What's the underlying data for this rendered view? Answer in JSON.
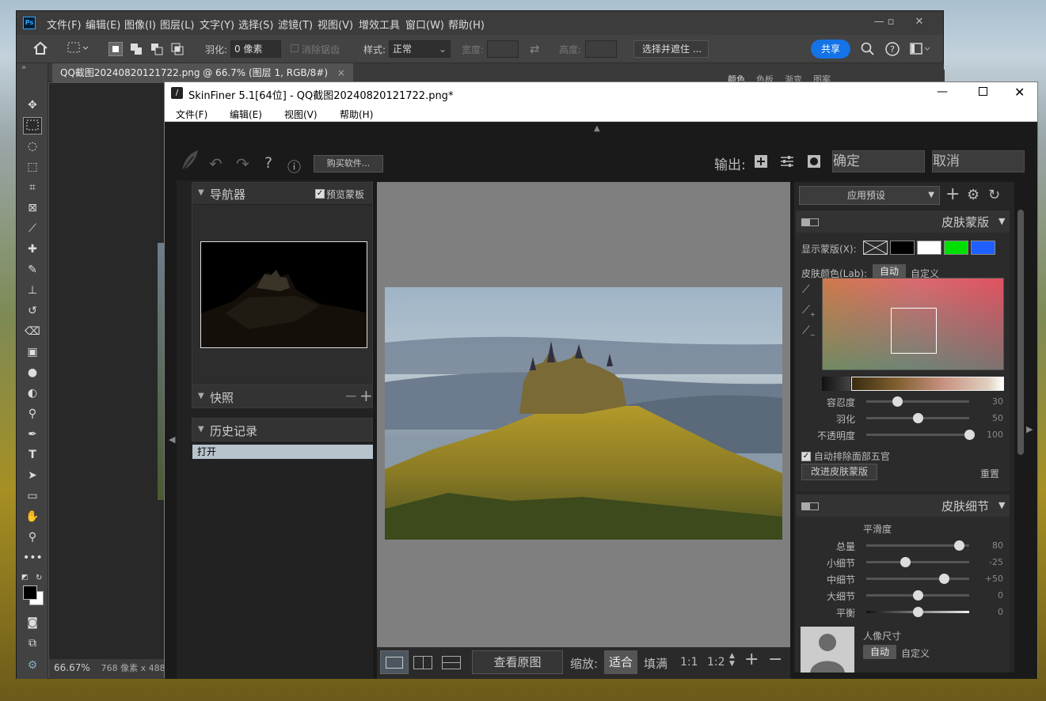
{
  "ps": {
    "logo": "Ps",
    "menu": [
      "文件(F)",
      "编辑(E)",
      "图像(I)",
      "图层(L)",
      "文字(Y)",
      "选择(S)",
      "滤镜(T)",
      "视图(V)",
      "增效工具",
      "窗口(W)",
      "帮助(H)"
    ],
    "options": {
      "feather_label": "羽化:",
      "feather_value": "0 像素",
      "antialias_label": "消除锯齿",
      "style_label": "样式:",
      "style_value": "正常",
      "width_label": "宽度:",
      "height_label": "高度:",
      "select_mask_label": "选择并遮住 ...",
      "share_label": "共享"
    },
    "doc_tab": "QQ截图20240820121722.png @ 66.7% (图层 1, RGB/8#)",
    "doc_tab_close": "×",
    "status_zoom": "66.67%",
    "status_size": "768 像素 x 488",
    "panel_tabs": [
      "颜色",
      "色板",
      "渐变",
      "图案"
    ]
  },
  "sf": {
    "title": "SkinFiner 5.1[64位] - QQ截图20240820121722.png*",
    "menu": [
      "文件(F)",
      "编辑(E)",
      "视图(V)",
      "帮助(H)"
    ],
    "buy_label": "购买软件...",
    "help_glyph": "?",
    "info_glyph": "ⓘ",
    "output_label": "输出:",
    "ok_label": "确定",
    "cancel_label": "取消",
    "navigator": {
      "title": "导航器",
      "preview_mask_label": "预览蒙板"
    },
    "snapshot": {
      "title": "快照"
    },
    "history": {
      "title": "历史记录",
      "items": [
        "打开"
      ]
    },
    "bottombar": {
      "view_original_label": "查看原图",
      "zoom_label": "缩放:",
      "fit_label": "适合",
      "fill_label": "填满",
      "ratio_1_1": "1:1",
      "ratio_1_2": "1:2"
    },
    "right": {
      "preset_label": "应用预设",
      "skin_mask": {
        "title": "皮肤蒙版",
        "show_mask_label": "显示蒙版(X):",
        "swatch_colors": [
          "#000000",
          "#ffffff",
          "#00e000",
          "#1f5fff"
        ],
        "skin_color_label": "皮肤颜色(Lab):",
        "auto_label": "自动",
        "custom_label": "自定义",
        "sliders": [
          {
            "label": "容忍度",
            "value": 30
          },
          {
            "label": "羽化",
            "value": 50
          },
          {
            "label": "不透明度",
            "value": 100
          }
        ],
        "auto_exclude_label": "自动排除面部五官",
        "improve_button": "改进皮肤蒙版",
        "reset_label": "重置"
      },
      "skin_detail": {
        "title": "皮肤细节",
        "smoothness_label": "平滑度",
        "sliders": [
          {
            "label": "总量",
            "value": 80,
            "display": "80"
          },
          {
            "label": "小细节",
            "value": -25,
            "display": "-25"
          },
          {
            "label": "中细节",
            "value": 50,
            "display": "+50"
          },
          {
            "label": "大细节",
            "value": 0,
            "display": "0"
          },
          {
            "label": "平衡",
            "value": 0,
            "display": "0"
          }
        ],
        "portrait_size_label": "人像尺寸",
        "auto_label": "自动",
        "custom_label": "自定义"
      }
    }
  }
}
